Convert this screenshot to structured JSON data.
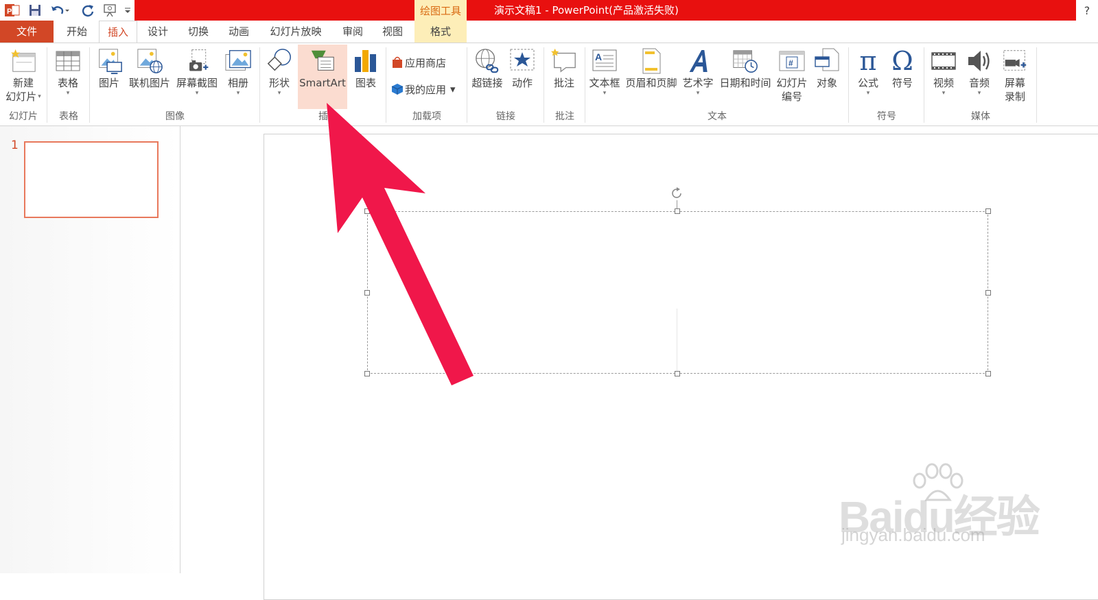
{
  "title_bar": {
    "contextual_tab_group": "绘图工具",
    "document_title": "演示文稿1 - PowerPoint(产品激活失败)",
    "help": "?"
  },
  "quick_access": [
    "powerpoint-logo-icon",
    "save-icon",
    "undo-icon",
    "redo-icon",
    "present-from-start-icon",
    "customize-qat-icon"
  ],
  "tabs": [
    {
      "label": "文件"
    },
    {
      "label": "开始"
    },
    {
      "label": "插入"
    },
    {
      "label": "设计"
    },
    {
      "label": "切换"
    },
    {
      "label": "动画"
    },
    {
      "label": "幻灯片放映"
    },
    {
      "label": "审阅"
    },
    {
      "label": "视图"
    },
    {
      "label": "格式"
    }
  ],
  "ribbon": {
    "new_slide": {
      "line1": "新建",
      "line2": "幻灯片"
    },
    "table": "表格",
    "picture": "图片",
    "online_picture": "联机图片",
    "screenshot": "屏幕截图",
    "album": "相册",
    "shapes": "形状",
    "smartart": "SmartArt",
    "chart": "图表",
    "app_store": "应用商店",
    "my_apps": "我的应用",
    "hyperlink": "超链接",
    "action": "动作",
    "comment": "批注",
    "textbox": "文本框",
    "header_footer": "页眉和页脚",
    "wordart": "艺术字",
    "datetime": "日期和时间",
    "slide_number": {
      "line1": "幻灯片",
      "line2": "编号"
    },
    "object": "对象",
    "equation": "公式",
    "symbol": "符号",
    "video": "视频",
    "audio": "音频",
    "screen_record": {
      "line1": "屏幕",
      "line2": "录制"
    },
    "pi_glyph": "π",
    "omega_glyph": "Ω",
    "groups": {
      "slides": "幻灯片",
      "tables": "表格",
      "images": "图像",
      "illustrations": "插",
      "addins": "加载项",
      "links": "链接",
      "comments": "批注",
      "text": "文本",
      "symbols": "符号",
      "media": "媒体"
    }
  },
  "thumbnails": [
    {
      "number": "1"
    }
  ],
  "watermark": {
    "logo": "Baidu经验",
    "url": "jingyan.baidu.com"
  },
  "colors": {
    "title_red": "#e8100f",
    "file_tab": "#d24726",
    "accent_orange": "#d24726",
    "arrow": "#f0174a",
    "ctx_yellow": "#fdeeb8"
  }
}
